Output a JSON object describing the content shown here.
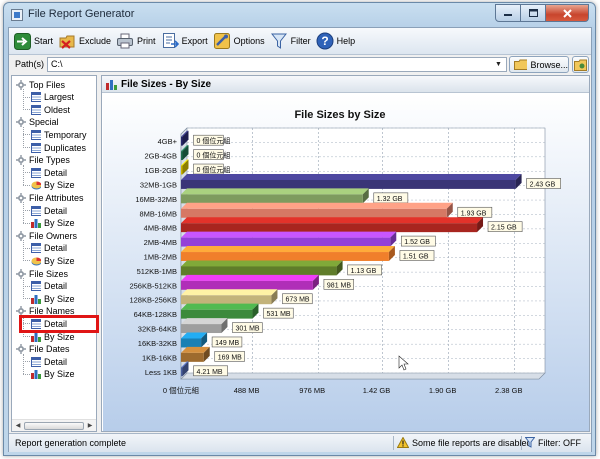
{
  "window": {
    "title": "File Report Generator"
  },
  "toolbar": {
    "buttons": [
      {
        "label": "Start",
        "icon": "start-arrow-icon"
      },
      {
        "label": "Exclude",
        "icon": "exclude-icon"
      },
      {
        "label": "Print",
        "icon": "printer-icon"
      },
      {
        "label": "Export",
        "icon": "export-icon"
      },
      {
        "label": "Options",
        "icon": "options-icon"
      },
      {
        "label": "Filter",
        "icon": "filter-icon"
      },
      {
        "label": "Help",
        "icon": "help-icon"
      }
    ]
  },
  "path": {
    "label": "Path(s)",
    "value": "C:\\",
    "browse_label": "Browse..."
  },
  "tree": {
    "groups": [
      {
        "label": "Top Files",
        "children": [
          "Largest",
          "Oldest"
        ]
      },
      {
        "label": "Special",
        "children": [
          "Temporary",
          "Duplicates"
        ]
      },
      {
        "label": "File Types",
        "children": [
          "Detail",
          "By Size"
        ]
      },
      {
        "label": "File Attributes",
        "children": [
          "Detail",
          "By Size"
        ]
      },
      {
        "label": "File Owners",
        "children": [
          "Detail",
          "By Size"
        ]
      },
      {
        "label": "File Sizes",
        "children": [
          "Detail",
          "By Size"
        ]
      },
      {
        "label": "File Names",
        "children": [
          "Detail",
          "By Size"
        ]
      },
      {
        "label": "File Dates",
        "children": [
          "Detail",
          "By Size"
        ]
      }
    ],
    "selected": "File Sizes / By Size"
  },
  "report": {
    "title": "File Sizes - By Size"
  },
  "chart_data": {
    "type": "bar",
    "orientation": "horizontal",
    "title": "File Sizes by Size",
    "categories": [
      "4GB+",
      "2GB-4GB",
      "1GB-2GB",
      "32MB-1GB",
      "16MB-32MB",
      "8MB-16MB",
      "4MB-8MB",
      "2MB-4MB",
      "1MB-2MB",
      "512KB-1MB",
      "256KB-512KB",
      "128KB-256KB",
      "64KB-128KB",
      "32KB-64KB",
      "16KB-32KB",
      "1KB-16KB",
      "Less 1KB"
    ],
    "values_gb": [
      0,
      0,
      0,
      2.43,
      1.32,
      1.93,
      2.15,
      1.52,
      1.51,
      1.13,
      0.958,
      0.657,
      0.519,
      0.294,
      0.146,
      0.165,
      0.0041
    ],
    "data_labels": [
      "0 個位元組",
      "0 個位元組",
      "0 個位元組",
      "2.43 GB",
      "1.32 GB",
      "1.93 GB",
      "2.15 GB",
      "1.52 GB",
      "1.51 GB",
      "1.13 GB",
      "981 MB",
      "673 MB",
      "531 MB",
      "301 MB",
      "149 MB",
      "169 MB",
      "4.21 MB"
    ],
    "colors": [
      "#2a2a6e",
      "#1f6e4e",
      "#c8b400",
      "#3a3577",
      "#7e9b5e",
      "#d67864",
      "#a8251f",
      "#9440d6",
      "#f07f2b",
      "#5f7d2a",
      "#b02eb8",
      "#c3b37a",
      "#3c8a3c",
      "#9e9e9e",
      "#1a80b4",
      "#9e6b2e",
      "#4a5f9e"
    ],
    "x_ticks": [
      "0 個位元組",
      "488 MB",
      "976 MB",
      "1.42 GB",
      "1.90 GB",
      "2.38 GB"
    ],
    "x_tick_values_gb": [
      0,
      0.4766,
      0.9531,
      1.42,
      1.9,
      2.38
    ],
    "xlim_gb": [
      0,
      2.6
    ],
    "grid": true
  },
  "status": {
    "left": "Report generation complete",
    "warning": "Some file reports are disabled",
    "filter": "Filter: OFF"
  }
}
